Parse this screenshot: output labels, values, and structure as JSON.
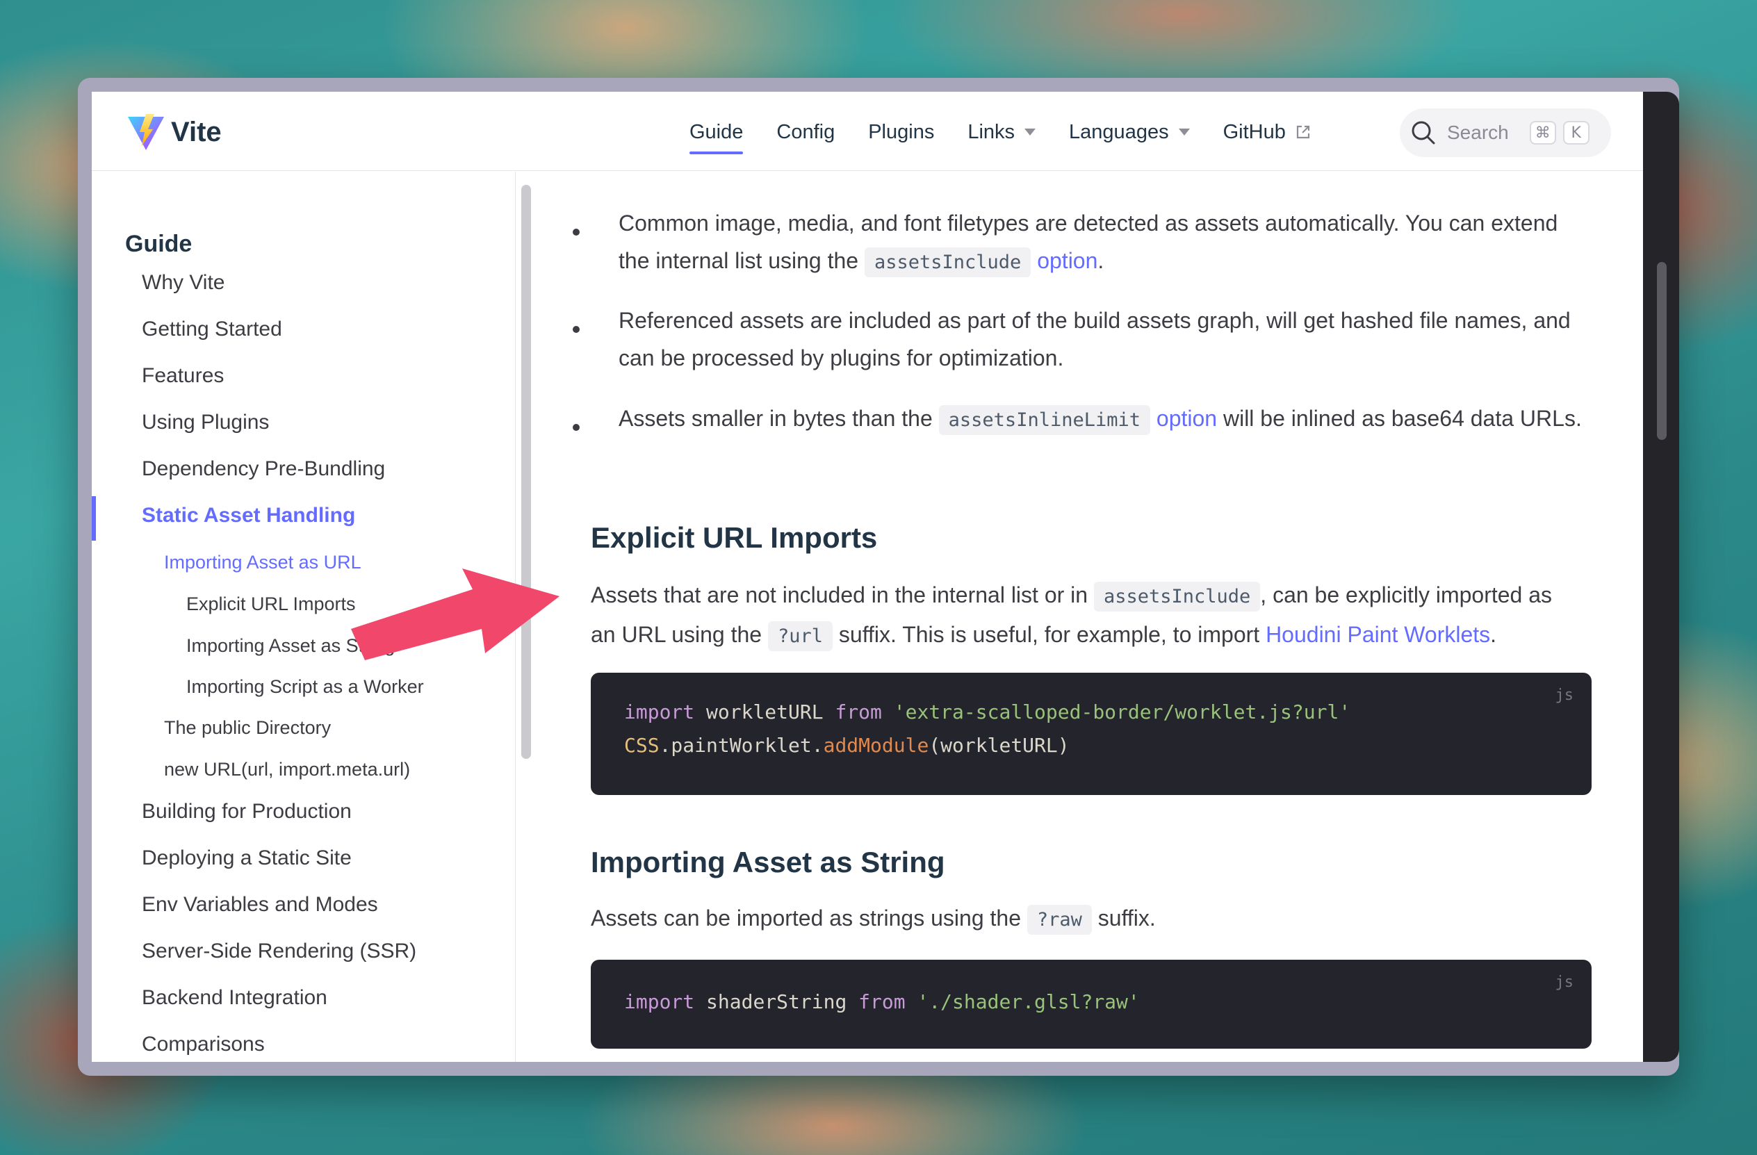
{
  "site": {
    "name": "Vite"
  },
  "nav": {
    "items": [
      {
        "label": "Guide",
        "active": true
      },
      {
        "label": "Config"
      },
      {
        "label": "Plugins"
      },
      {
        "label": "Links",
        "dropdown": true
      },
      {
        "label": "Languages",
        "dropdown": true
      },
      {
        "label": "GitHub",
        "external": true
      }
    ],
    "search": {
      "placeholder": "Search",
      "shortcut_1": "⌘",
      "shortcut_2": "K"
    }
  },
  "sidebar": {
    "title": "Guide",
    "items": [
      {
        "label": "Why Vite"
      },
      {
        "label": "Getting Started"
      },
      {
        "label": "Features"
      },
      {
        "label": "Using Plugins"
      },
      {
        "label": "Dependency Pre-Bundling"
      },
      {
        "label": "Static Asset Handling",
        "active": true
      },
      {
        "label": "Importing Asset as URL",
        "active": true
      },
      {
        "label": "Explicit URL Imports"
      },
      {
        "label": "Importing Asset as String"
      },
      {
        "label": "Importing Script as a Worker"
      },
      {
        "label": "The public Directory"
      },
      {
        "label": "new URL(url, import.meta.url)"
      },
      {
        "label": "Building for Production"
      },
      {
        "label": "Deploying a Static Site"
      },
      {
        "label": "Env Variables and Modes"
      },
      {
        "label": "Server-Side Rendering (SSR)"
      },
      {
        "label": "Backend Integration"
      },
      {
        "label": "Comparisons"
      }
    ]
  },
  "content": {
    "bullet1": {
      "text_a": "Common image, media, and font filetypes are detected as assets automatically. You can extend the internal list using the",
      "code": "assetsInclude",
      "link": "option",
      "text_b": "."
    },
    "bullet2": {
      "text": "Referenced assets are included as part of the build assets graph, will get hashed file names, and can be processed by plugins for optimization."
    },
    "bullet3": {
      "text_a": "Assets smaller in bytes than the",
      "code": "assetsInlineLimit",
      "link": "option",
      "text_b": "will be inlined as base64 data URLs."
    },
    "section1": {
      "heading": "Explicit URL Imports",
      "text_a": "Assets that are not included in the internal list or in",
      "code_a": "assetsInclude",
      "text_b": ", can be explicitly imported as an URL using the",
      "code_b": "?url",
      "text_c": "suffix. This is useful, for example, to import",
      "link": "Houdini Paint Worklets",
      "text_d": ".",
      "code_block": {
        "lang": "js",
        "line1": {
          "kw1": "import",
          "id": " workletURL ",
          "kw2": "from",
          "str": " 'extra-scalloped-border/worklet.js?url'"
        },
        "line2": {
          "obj": "CSS",
          "dot1": ".paintWorklet.",
          "fn": "addModule",
          "args": "(workletURL)"
        }
      }
    },
    "section2": {
      "heading": "Importing Asset as String",
      "text_a": "Assets can be imported as strings using the",
      "code": "?raw",
      "text_b": "suffix.",
      "code_block": {
        "lang": "js",
        "line1": {
          "kw1": "import",
          "id": " shaderString ",
          "kw2": "from",
          "str": " './shader.glsl?raw'"
        }
      }
    }
  },
  "colors": {
    "accent": "#646cff",
    "annotation_arrow": "#f0476b",
    "code_bg": "#24242c"
  }
}
